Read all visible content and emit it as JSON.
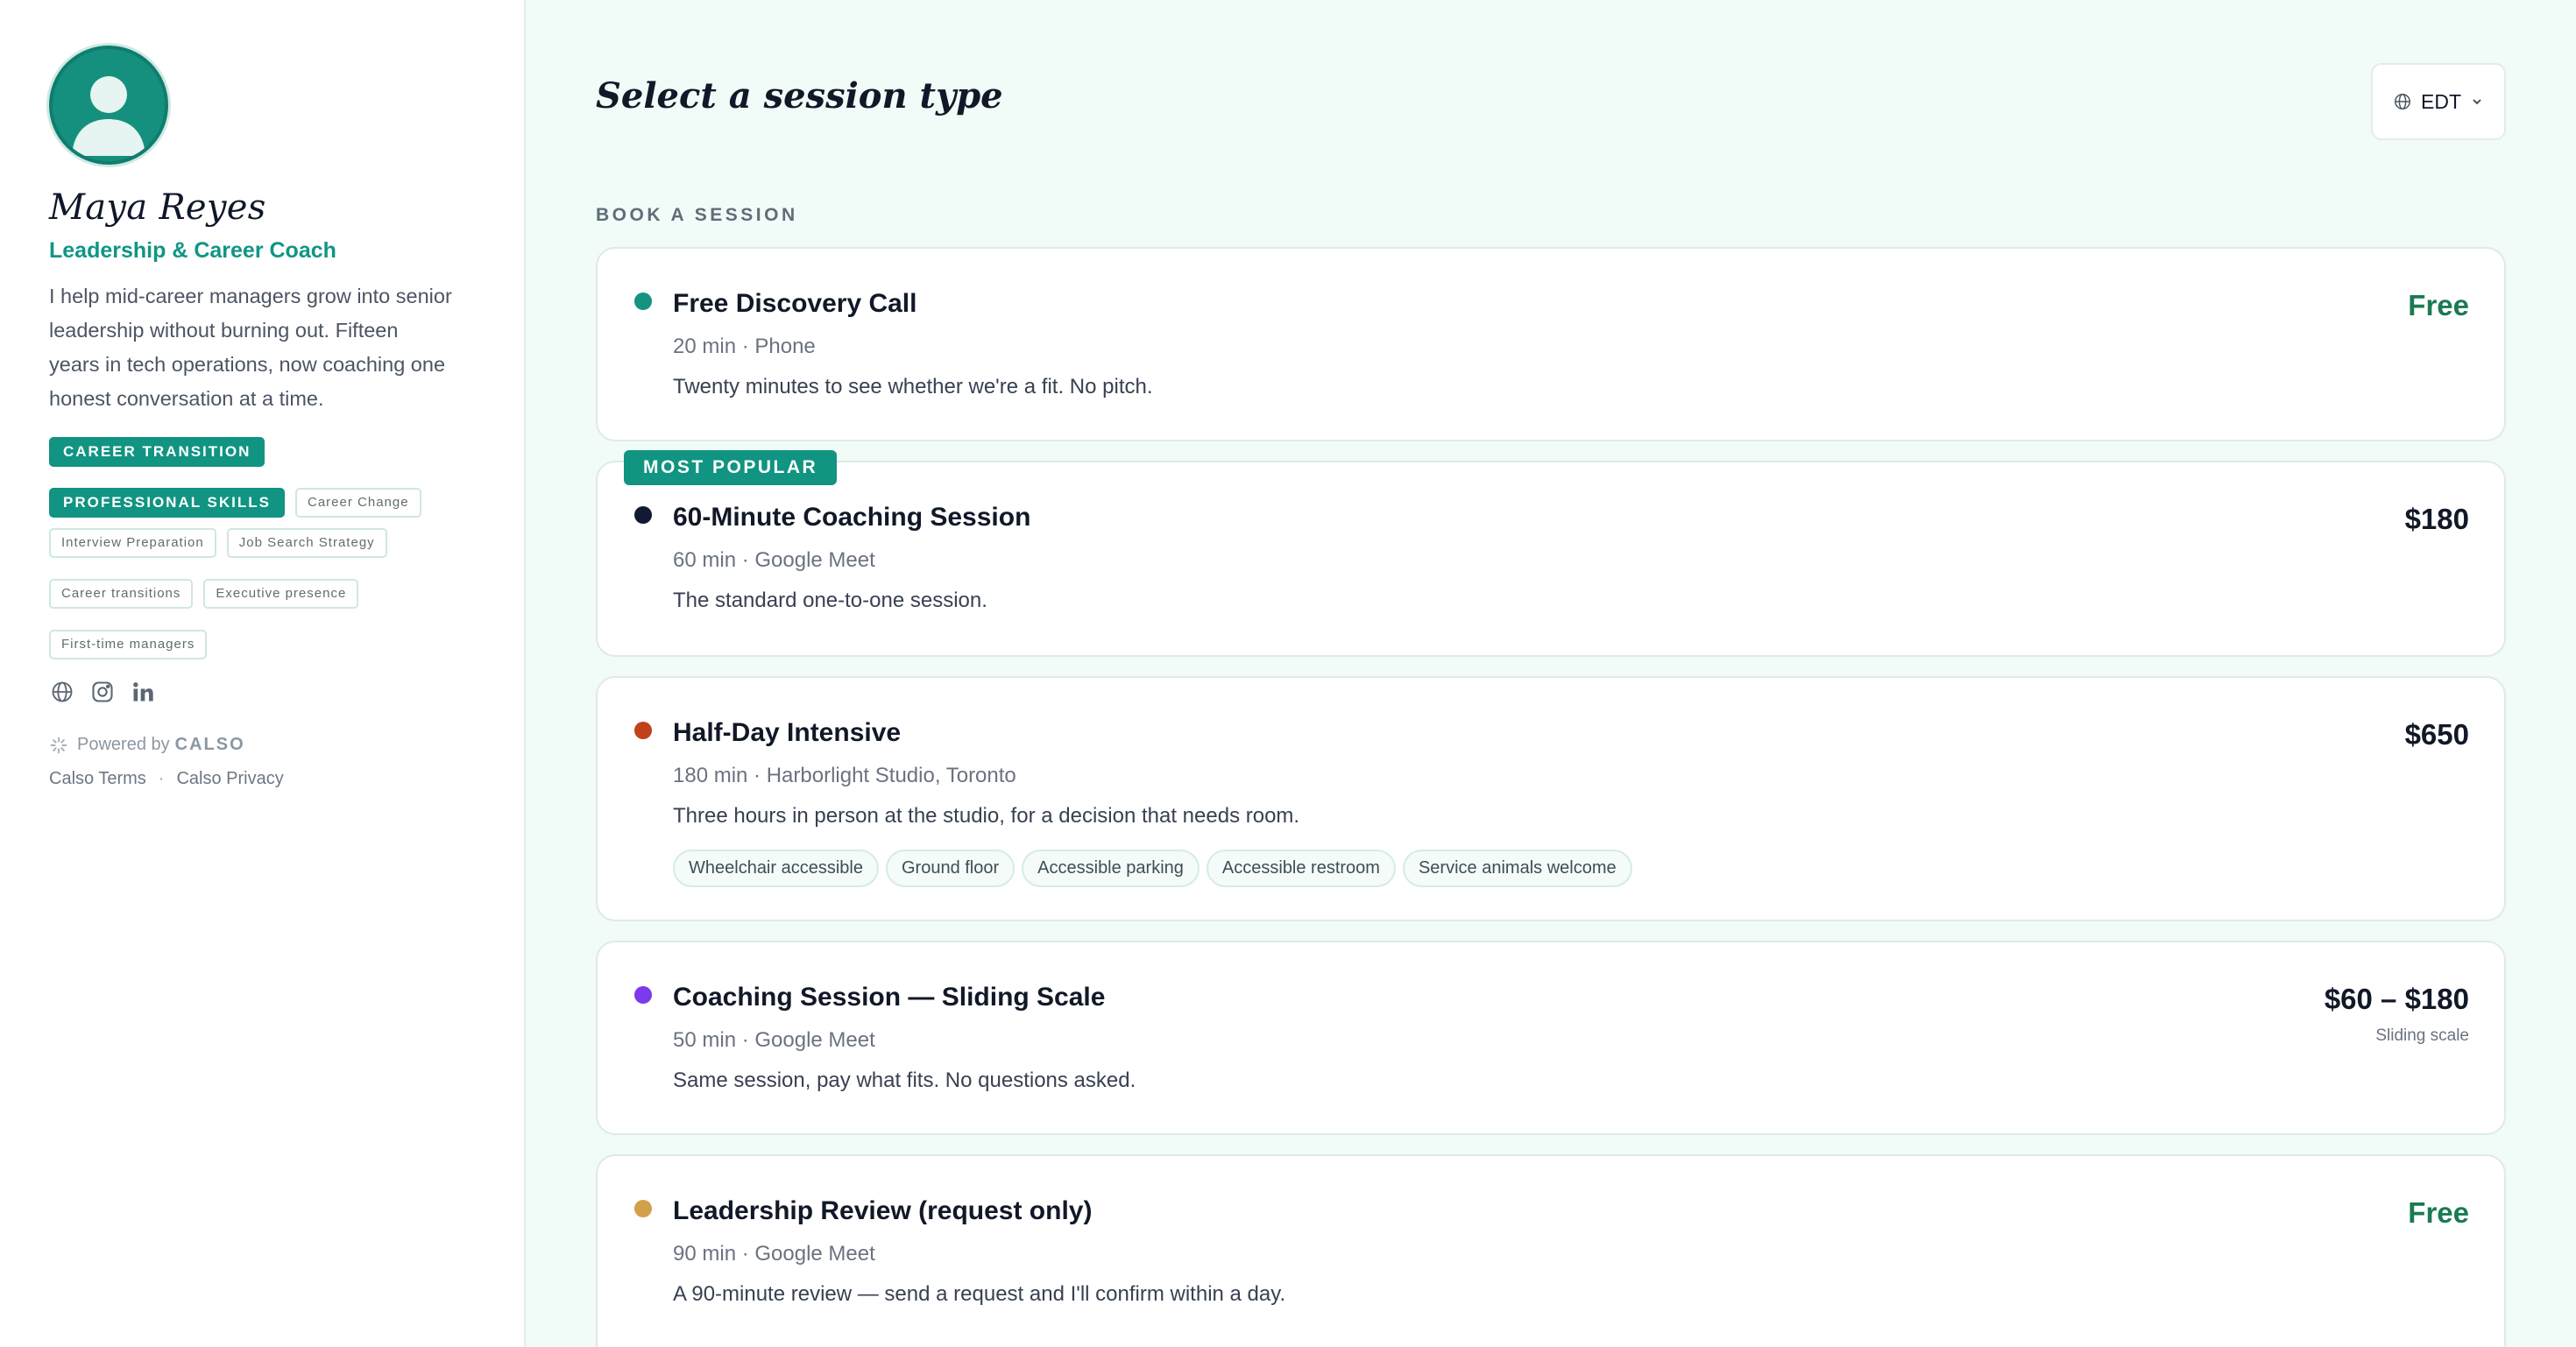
{
  "profile": {
    "name": "Maya Reyes",
    "title": "Leadership & Career Coach",
    "bio": "I help mid-career managers grow into senior leadership without burning out. Fifteen years in tech operations, now coaching one honest conversation at a time.",
    "tags_primary": [
      "CAREER TRANSITION",
      "PROFESSIONAL SKILLS"
    ],
    "tags_secondary": [
      "Career Change",
      "Interview Preparation",
      "Job Search Strategy",
      "Career transitions",
      "Executive presence",
      "First-time managers"
    ],
    "socials": [
      "globe-icon",
      "instagram-icon",
      "linkedin-icon"
    ]
  },
  "footer": {
    "powered_prefix": "Powered by",
    "powered_brand": "CALSO",
    "terms": "Calso Terms",
    "separator": "·",
    "privacy": "Calso Privacy"
  },
  "main": {
    "heading": "Select a session type",
    "timezone": "EDT",
    "section_label": "BOOK A SESSION"
  },
  "sessions": [
    {
      "title": "Free Discovery Call",
      "meta": "20 min · Phone",
      "desc": "Twenty minutes to see whether we're a fit. No pitch.",
      "price": "Free",
      "dot_color": "#159282"
    },
    {
      "title": "60-Minute Coaching Session",
      "meta": "60 min · Google Meet",
      "desc": "The standard one-to-one session.",
      "price": "$180",
      "badge": "MOST POPULAR",
      "dot_color": "#111a33"
    },
    {
      "title": "Half-Day Intensive",
      "meta": "180 min · Harborlight Studio, Toronto",
      "desc": "Three hours in person at the studio, for a decision that needs room.",
      "price": "$650",
      "dot_color": "#c0411a",
      "amenities": [
        "Wheelchair accessible",
        "Ground floor",
        "Accessible parking",
        "Accessible restroom",
        "Service animals welcome"
      ]
    },
    {
      "title": "Coaching Session — Sliding Scale",
      "meta": "50 min · Google Meet",
      "desc": "Same session, pay what fits. No questions asked.",
      "price": "$60 – $180",
      "price_note": "Sliding scale",
      "dot_color": "#7c3aed"
    },
    {
      "title": "Leadership Review (request only)",
      "meta": "90 min · Google Meet",
      "desc": "A 90-minute review — send a request and I'll confirm within a day.",
      "price": "Free",
      "dot_color": "#d2a04a"
    }
  ]
}
